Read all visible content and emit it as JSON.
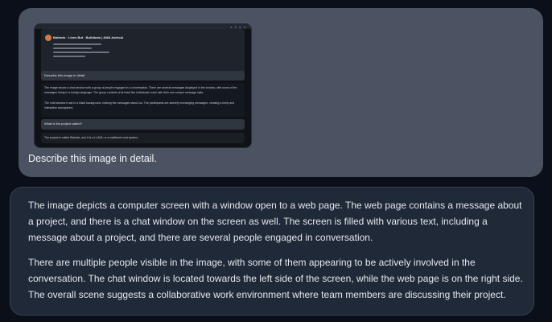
{
  "user_message": {
    "thumbnail": {
      "header_title": "Baldwin · Lines Bot · Buildbots | AMA Astrical",
      "prompt_label": "Describe this image in detail.",
      "response_p1": "The image shows a chat window with a group of people engaged in a conversation. There are several messages displayed in the window, with some of the messages being in a foreign language. The group consists of at least five individuals, each with their own unique message style.",
      "response_p2": "The chat window is set in a black background, making the messages stand out. The participants are actively exchanging messages, creating a lively and interactive atmosphere.",
      "question": "What is the project called?",
      "answer": "The project is called Baldwin, and it is a LLAVA, or a multilevel chat system."
    },
    "text": "Describe this image in detail."
  },
  "bot_message": {
    "paragraph1": "The image depicts a computer screen with a window open to a web page. The web page contains a message about a project, and there is a chat window on the screen as well. The screen is filled with various text, including a message about a project, and there are several people engaged in conversation.",
    "paragraph2": "There are multiple people visible in the image, with some of them appearing to be actively involved in the conversation. The chat window is located towards the left side of the screen, while the web page is on the right side. The overall scene suggests a collaborative work environment where team members are discussing their project."
  }
}
